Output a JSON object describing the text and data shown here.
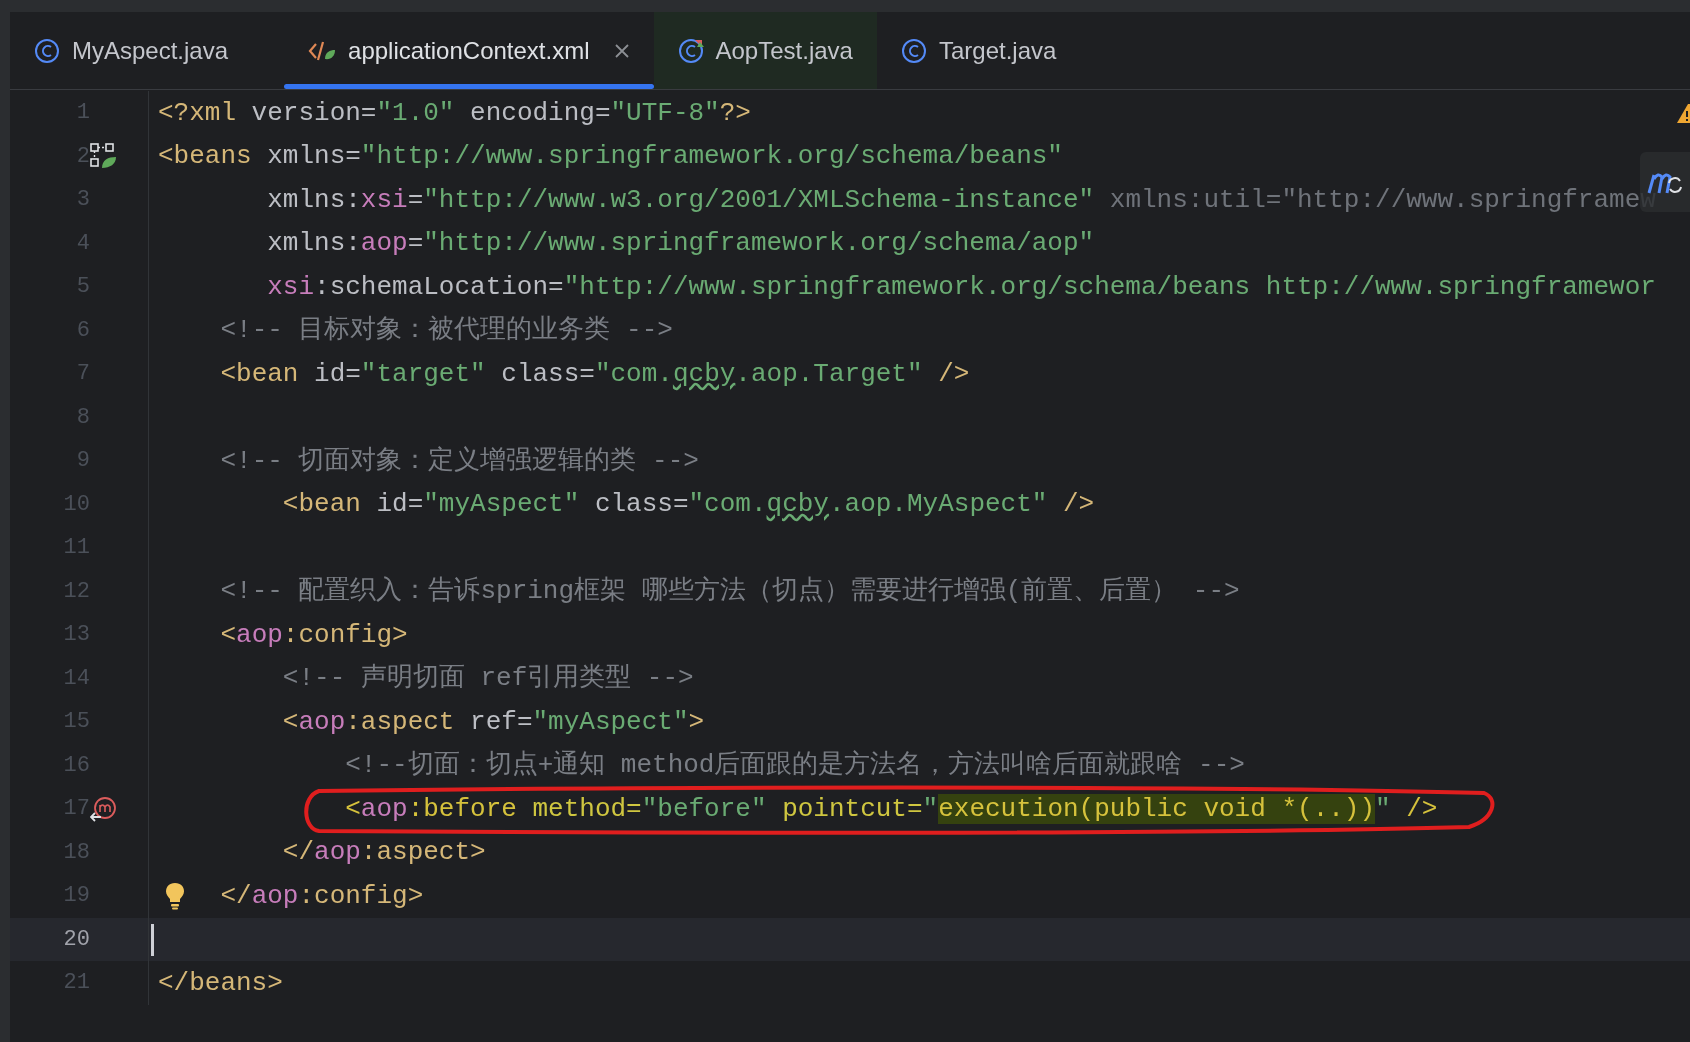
{
  "tabs": [
    {
      "label": "MyAspect.java",
      "kind": "class",
      "selected": false,
      "closable": false
    },
    {
      "label": "applicationContext.xml",
      "kind": "xml",
      "selected": true,
      "closable": true
    },
    {
      "label": "AopTest.java",
      "kind": "test",
      "selected": false,
      "closable": false
    },
    {
      "label": "Target.java",
      "kind": "class",
      "selected": false,
      "closable": false
    }
  ],
  "editor": {
    "lines": [
      {
        "number": "1",
        "current": false,
        "kind": "plain",
        "tokens": [
          {
            "kind": "tag",
            "t": "<?xml"
          },
          {
            "kind": "attr",
            "t": " version="
          },
          {
            "kind": "value",
            "t": "\"1.0\""
          },
          {
            "kind": "attr",
            "t": " encoding="
          },
          {
            "kind": "value",
            "t": "\"UTF-8\""
          },
          {
            "kind": "tag",
            "t": "?>"
          }
        ]
      },
      {
        "number": "2",
        "current": false,
        "kind": "bean",
        "tokens": [
          {
            "kind": "tag",
            "t": "<beans"
          },
          {
            "kind": "attr",
            "t": " xmlns="
          },
          {
            "kind": "value",
            "t": "\"http://www.springframework.org/schema/beans\""
          }
        ]
      },
      {
        "number": "3",
        "current": false,
        "kind": "plain",
        "tokens": [
          {
            "kind": "attr",
            "t": "       xmlns:"
          },
          {
            "kind": "ns",
            "t": "xsi"
          },
          {
            "kind": "attr",
            "t": "="
          },
          {
            "kind": "value",
            "t": "\"http://www.w3.org/2001/XMLSchema-instance\""
          },
          {
            "kind": "dim",
            "t": " xmlns:util=\"http://www.springframew"
          }
        ]
      },
      {
        "number": "4",
        "current": false,
        "kind": "plain",
        "tokens": [
          {
            "kind": "attr",
            "t": "       xmlns:"
          },
          {
            "kind": "ns",
            "t": "aop"
          },
          {
            "kind": "attr",
            "t": "="
          },
          {
            "kind": "value",
            "t": "\"http://www.springframework.org/schema/aop\""
          }
        ]
      },
      {
        "number": "5",
        "current": false,
        "kind": "plain",
        "tokens": [
          {
            "kind": "ns",
            "t": "       xsi"
          },
          {
            "kind": "attr",
            "t": ":schemaLocation="
          },
          {
            "kind": "value",
            "t": "\"http://www.springframework.org/schema/beans http://www.springframewor"
          }
        ]
      },
      {
        "number": "6",
        "current": false,
        "kind": "plain",
        "tokens": [
          {
            "kind": "comment",
            "t": "    <!-- 目标对象：被代理的业务类 -->"
          }
        ]
      },
      {
        "number": "7",
        "current": false,
        "kind": "plain",
        "tokens": [
          {
            "kind": "tag",
            "t": "    <bean"
          },
          {
            "kind": "attr",
            "t": " id="
          },
          {
            "kind": "value",
            "t": "\"target\""
          },
          {
            "kind": "attr",
            "t": " class="
          },
          {
            "kind": "value",
            "t": "\"com."
          },
          {
            "kind": "typo",
            "t": "qcby"
          },
          {
            "kind": "value",
            "t": ".aop.Target\""
          },
          {
            "kind": "tag",
            "t": " />"
          }
        ]
      },
      {
        "number": "8",
        "current": false,
        "kind": "plain"
      },
      {
        "number": "9",
        "current": false,
        "kind": "plain",
        "tokens": [
          {
            "kind": "comment",
            "t": "    <!-- 切面对象：定义增强逻辑的类 -->"
          }
        ]
      },
      {
        "number": "10",
        "current": false,
        "kind": "plain",
        "tokens": [
          {
            "kind": "tag",
            "t": "        <bean"
          },
          {
            "kind": "attr",
            "t": " id="
          },
          {
            "kind": "value",
            "t": "\"myAspect\""
          },
          {
            "kind": "attr",
            "t": " class="
          },
          {
            "kind": "value",
            "t": "\"com."
          },
          {
            "kind": "typo",
            "t": "qcby"
          },
          {
            "kind": "value",
            "t": ".aop.MyAspect\""
          },
          {
            "kind": "tag",
            "t": " />"
          }
        ]
      },
      {
        "number": "11",
        "current": false,
        "kind": "plain"
      },
      {
        "number": "12",
        "current": false,
        "kind": "plain",
        "tokens": [
          {
            "kind": "comment",
            "t": "    <!-- 配置织入：告诉spring框架 哪些方法（切点）需要进行增强(前置、后置） -->"
          }
        ]
      },
      {
        "number": "13",
        "current": false,
        "kind": "plain",
        "tokens": [
          {
            "kind": "tag",
            "t": "    <"
          },
          {
            "kind": "ns",
            "t": "aop"
          },
          {
            "kind": "tag",
            "t": ":config>"
          }
        ]
      },
      {
        "number": "14",
        "current": false,
        "kind": "plain",
        "tokens": [
          {
            "kind": "comment",
            "t": "        <!-- 声明切面 ref引用类型 -->"
          }
        ]
      },
      {
        "number": "15",
        "current": false,
        "kind": "plain",
        "tokens": [
          {
            "kind": "tag",
            "t": "        <"
          },
          {
            "kind": "ns",
            "t": "aop"
          },
          {
            "kind": "tag",
            "t": ":aspect"
          },
          {
            "kind": "attr",
            "t": " ref="
          },
          {
            "kind": "value",
            "t": "\"myAspect\""
          },
          {
            "kind": "tag",
            "t": ">"
          }
        ]
      },
      {
        "number": "16",
        "current": false,
        "kind": "plain",
        "tokens": [
          {
            "kind": "comment",
            "t": "            <!--切面：切点+通知 method后面跟的是方法名，方法叫啥后面就跟啥 -->"
          }
        ]
      },
      {
        "number": "17",
        "current": false,
        "kind": "method",
        "circled": true,
        "tokens": [
          {
            "kind": "hltag",
            "t": "            <"
          },
          {
            "kind": "ns",
            "t": "aop"
          },
          {
            "kind": "hltag",
            "t": ":before"
          },
          {
            "kind": "hlattr",
            "t": " method="
          },
          {
            "kind": "value",
            "t": "\"before\""
          },
          {
            "kind": "hlattr",
            "t": " pointcut="
          },
          {
            "kind": "value",
            "t": "\""
          },
          {
            "kind": "found",
            "t": "execution(public void *(..))"
          },
          {
            "kind": "value",
            "t": "\""
          },
          {
            "kind": "hltag",
            "t": " />"
          }
        ]
      },
      {
        "number": "18",
        "current": false,
        "kind": "plain",
        "tokens": [
          {
            "kind": "tag",
            "t": "        </"
          },
          {
            "kind": "ns",
            "t": "aop"
          },
          {
            "kind": "tag",
            "t": ":aspect>"
          }
        ]
      },
      {
        "number": "19",
        "current": false,
        "kind": "bulb",
        "tokens": [
          {
            "kind": "tag",
            "t": "    </"
          },
          {
            "kind": "ns",
            "t": "aop"
          },
          {
            "kind": "tag",
            "t": ":config>"
          }
        ]
      },
      {
        "number": "20",
        "current": true,
        "kind": "plain"
      },
      {
        "number": "21",
        "current": false,
        "kind": "plain",
        "tokens": [
          {
            "kind": "tag",
            "t": "</beans>"
          }
        ]
      }
    ]
  }
}
